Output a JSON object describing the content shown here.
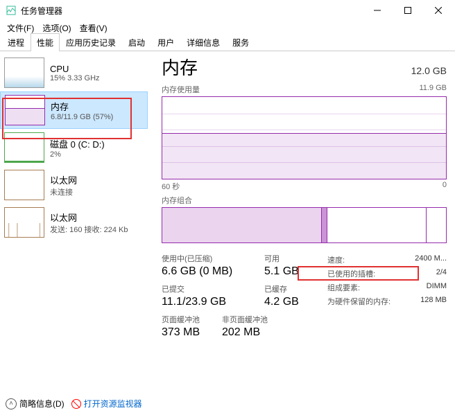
{
  "window": {
    "title": "任务管理器"
  },
  "menu": {
    "file": "文件(F)",
    "options": "选项(O)",
    "view": "查看(V)"
  },
  "tabs": [
    "进程",
    "性能",
    "应用历史记录",
    "启动",
    "用户",
    "详细信息",
    "服务"
  ],
  "activeTab": 1,
  "sidebar": {
    "items": [
      {
        "title": "CPU",
        "sub": "15% 3.33 GHz"
      },
      {
        "title": "内存",
        "sub": "6.8/11.9 GB (57%)"
      },
      {
        "title": "磁盘 0 (C: D:)",
        "sub": "2%"
      },
      {
        "title": "以太网",
        "sub": "未连接"
      },
      {
        "title": "以太网",
        "sub": "发送: 160 接收: 224 Kb"
      }
    ],
    "selected": 1
  },
  "main": {
    "title": "内存",
    "total": "12.0 GB",
    "usageLabel": "内存使用量",
    "usageMax": "11.9 GB",
    "xLeft": "60 秒",
    "xRight": "0",
    "compLabel": "内存组合",
    "stats": {
      "inuse_lbl": "使用中(已压缩)",
      "inuse_val": "6.6 GB (0 MB)",
      "avail_lbl": "可用",
      "avail_val": "5.1 GB",
      "commit_lbl": "已提交",
      "commit_val": "11.1/23.9 GB",
      "cached_lbl": "已缓存",
      "cached_val": "4.2 GB",
      "paged_lbl": "页面缓冲池",
      "paged_val": "373 MB",
      "nonpaged_lbl": "非页面缓冲池",
      "nonpaged_val": "202 MB"
    },
    "specs": {
      "speed_k": "速度:",
      "speed_v": "2400 M...",
      "slots_k": "已使用的插槽:",
      "slots_v": "2/4",
      "form_k": "组成要素:",
      "form_v": "DIMM",
      "reserved_k": "为硬件保留的内存:",
      "reserved_v": "128 MB"
    }
  },
  "footer": {
    "brief": "简略信息(D)",
    "monitor": "打开资源监视器"
  }
}
